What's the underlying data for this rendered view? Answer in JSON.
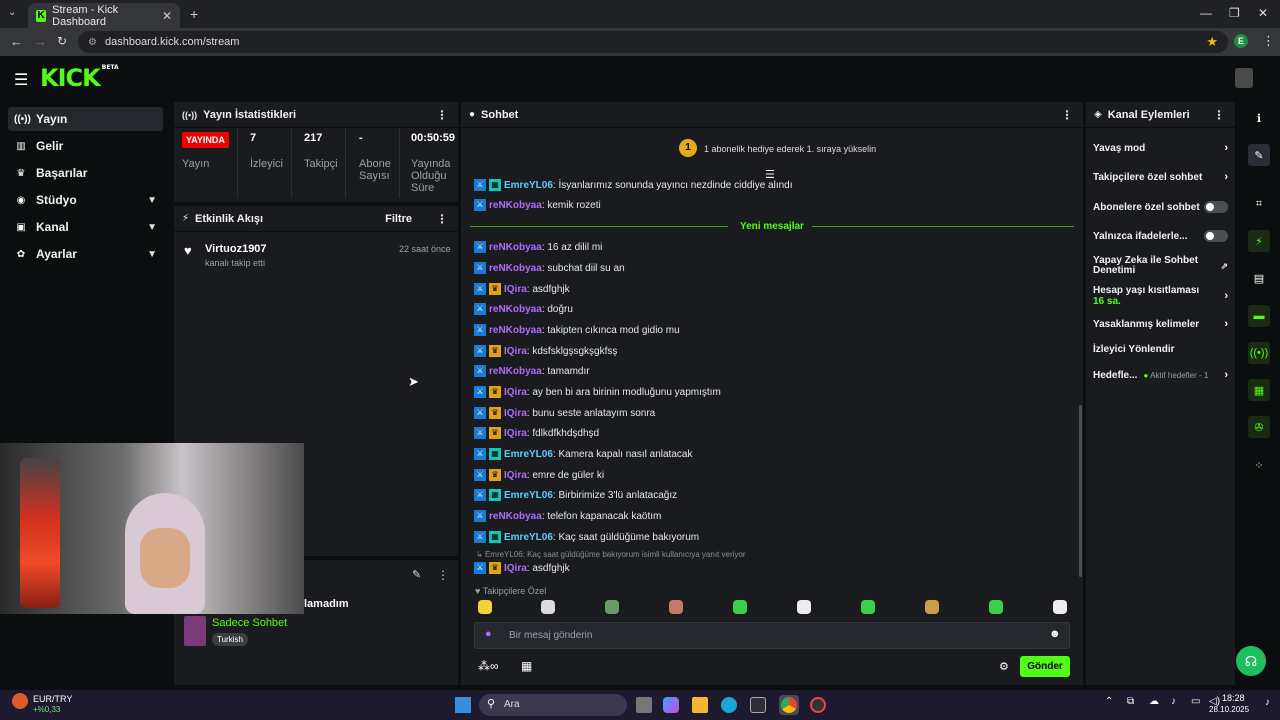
{
  "browser": {
    "tab_title": "Stream - Kick Dashboard",
    "url": "dashboard.kick.com/stream",
    "profile_initial": "E"
  },
  "header": {
    "logo": "KICK",
    "logo_badge": "BETA"
  },
  "sidebar": {
    "items": [
      {
        "label": "Yayın",
        "icon": "stream-icon"
      },
      {
        "label": "Gelir",
        "icon": "revenue-icon"
      },
      {
        "label": "Başarılar",
        "icon": "trophy-icon"
      },
      {
        "label": "Stüdyo",
        "icon": "studio-icon"
      },
      {
        "label": "Kanal",
        "icon": "channel-icon"
      },
      {
        "label": "Ayarlar",
        "icon": "gear-icon"
      }
    ]
  },
  "stats": {
    "title": "Yayın İstatistikleri",
    "live_badge": "YAYINDA",
    "live_label": "Yayın",
    "viewers_value": "7",
    "viewers_label": "İzleyici",
    "followers_value": "217",
    "followers_label": "Takipçi",
    "subs_value": "-",
    "subs_label_1": "Abone",
    "subs_label_2": "Sayısı",
    "uptime_value": "00:50:59",
    "uptime_label_1": "Yayında",
    "uptime_label_2": "Olduğu",
    "uptime_label_3": "Süre"
  },
  "activity": {
    "title": "Etkinlik Akışı",
    "filter": "Filtre",
    "event_user": "Virtuoz1907",
    "event_text": "kanalı takip etti",
    "event_time": "22 saat önce"
  },
  "lower_panel": {
    "partial_text": "lamadım",
    "mode": "Sadece Sohbet",
    "language": "Turkish"
  },
  "chat": {
    "title": "Sohbet",
    "goal_rank": "1",
    "goal_text": "1 abonelik hediye ederek 1. sıraya yükselin",
    "new_messages": "Yeni mesajlar",
    "messages": [
      {
        "user": "EmreYL06",
        "text": ": İsyanlarımız sonunda yayıncı nezdinde ciddiye alındı",
        "badge": "og",
        "cls": "u-emre"
      },
      {
        "user": "reNKobyaa",
        "text": ": kemik rozeti",
        "badge": "",
        "cls": "u-ren"
      },
      {
        "user": "reNKobyaa",
        "text": ": 16 az dilil mi",
        "badge": "",
        "cls": "u-ren"
      },
      {
        "user": "reNKobyaa",
        "text": ": subchat diil su an",
        "badge": "",
        "cls": "u-ren"
      },
      {
        "user": "IQira",
        "text": ": asdfghjk",
        "badge": "vip",
        "cls": "u-iqira"
      },
      {
        "user": "reNKobyaa",
        "text": ": doğru",
        "badge": "",
        "cls": "u-ren"
      },
      {
        "user": "reNKobyaa",
        "text": ": takipten cıkınca mod gidio mu",
        "badge": "",
        "cls": "u-ren"
      },
      {
        "user": "IQira",
        "text": ": kdsfsklgşsgkşgkfsş",
        "badge": "vip",
        "cls": "u-iqira"
      },
      {
        "user": "reNKobyaa",
        "text": ": tamamdır",
        "badge": "",
        "cls": "u-ren"
      },
      {
        "user": "IQira",
        "text": ": ay ben bi ara birinin modluğunu yapmıştım",
        "badge": "vip",
        "cls": "u-iqira"
      },
      {
        "user": "IQira",
        "text": ": bunu seste anlatayım sonra",
        "badge": "vip",
        "cls": "u-iqira"
      },
      {
        "user": "IQira",
        "text": ": fdlkdfkhdşdhşd",
        "badge": "vip",
        "cls": "u-iqira"
      },
      {
        "user": "EmreYL06",
        "text": ": Kamera kapalı nasıl anlatacak",
        "badge": "og",
        "cls": "u-emre"
      },
      {
        "user": "IQira",
        "text": ": emre de güler ki",
        "badge": "vip",
        "cls": "u-iqira"
      },
      {
        "user": "EmreYL06",
        "text": ": Birbirimize 3'lü anlatacağız",
        "badge": "og",
        "cls": "u-emre"
      },
      {
        "user": "reNKobyaa",
        "text": ": telefon kapanacak kaötım",
        "badge": "",
        "cls": "u-ren"
      },
      {
        "user": "EmreYL06",
        "text": ": Kaç saat güldüğüme bakıyorum",
        "badge": "og",
        "cls": "u-emre"
      }
    ],
    "reply_hint": "EmreYL06: Kaç saat güldüğüme bakıyorum isimli kullanıcıya yanıt veriyor",
    "reply_user": "IQira",
    "reply_text": ": asdfghjk",
    "followers_only": "Takipçilere Özel",
    "input_placeholder": "Bir mesaj gönderin",
    "send": "Gönder"
  },
  "channel_actions": {
    "title": "Kanal Eylemleri",
    "slow_mode": "Yavaş mod",
    "followers_chat": "Takipçilere özel sohbet",
    "subs_chat": "Abonelere özel sohbet",
    "emotes_only": "Yalnızca ifadelerle...",
    "ai_moderation_1": "Yapay Zeka ile Sohbet",
    "ai_moderation_2": "Denetimi",
    "age_restriction": "Hesap yaşı kısıtlaması",
    "age_value": "16 sa.",
    "banned_words": "Yasaklanmış kelimeler",
    "redirect": "İzleyici Yönlendir",
    "goals": "Hedefle...",
    "active_goals": "Aktif hedefler - 1"
  },
  "taskbar": {
    "ticker": "EUR/TRY",
    "ticker_change": "+%0,33",
    "search": "Ara",
    "time": "18:28",
    "date": "28.10.2025"
  },
  "colors": {
    "accent": "#53fc18",
    "live": "#eb0400",
    "panel": "#191b1f",
    "bg": "#0b0e0f"
  }
}
